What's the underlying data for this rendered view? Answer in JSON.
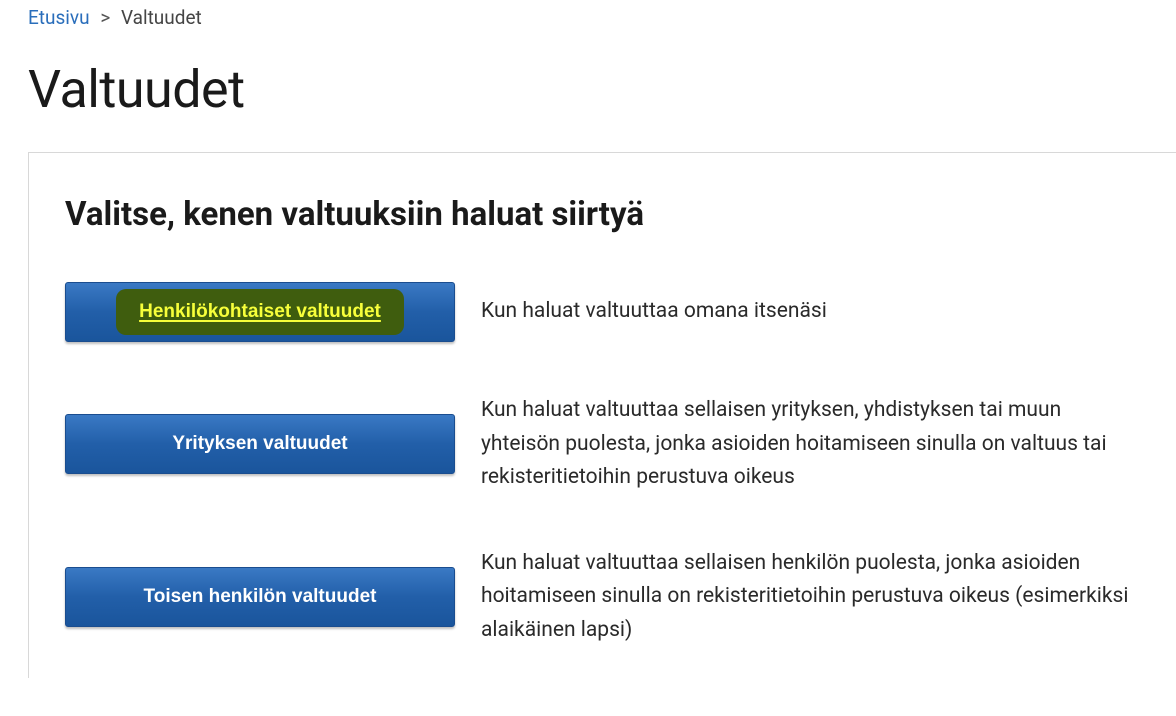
{
  "breadcrumb": {
    "home_label": "Etusivu",
    "separator": ">",
    "current": "Valtuudet"
  },
  "page_title": "Valtuudet",
  "card": {
    "heading": "Valitse, kenen valtuuksiin haluat siirtyä",
    "options": [
      {
        "button_label": "Henkilökohtaiset valtuudet",
        "description": "Kun haluat valtuuttaa omana itsenäsi",
        "highlighted": true
      },
      {
        "button_label": "Yrityksen valtuudet",
        "description": "Kun haluat valtuuttaa sellaisen yrityksen, yhdistyksen tai muun yhteisön puolesta, jonka asioiden hoitamiseen sinulla on valtuus tai rekisteritietoihin perustuva oikeus",
        "highlighted": false
      },
      {
        "button_label": "Toisen henkilön valtuudet",
        "description": "Kun haluat valtuuttaa sellaisen henkilön puolesta, jonka asioiden hoitamiseen sinulla on rekisteritietoihin perustuva oikeus (esimerkiksi alaikäinen lapsi)",
        "highlighted": false
      }
    ]
  }
}
